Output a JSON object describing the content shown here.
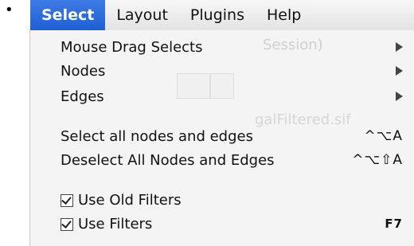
{
  "menubar": {
    "items": [
      {
        "label": "Select",
        "active": true
      },
      {
        "label": "Layout",
        "active": false
      },
      {
        "label": "Plugins",
        "active": false
      },
      {
        "label": "Help",
        "active": false
      }
    ]
  },
  "background_ghost": {
    "window_title_fragment": "Session)",
    "file_name": "galFiltered.sif"
  },
  "menu": {
    "mouse_drag_selects": "Mouse Drag Selects",
    "nodes": "Nodes",
    "edges": "Edges",
    "select_all": "Select all nodes and edges",
    "select_all_shortcut": "^⌥A",
    "deselect_all": "Deselect All Nodes and Edges",
    "deselect_all_shortcut": "^⌥⇧A",
    "use_old_filters": "Use Old Filters",
    "use_filters": "Use Filters",
    "use_filters_shortcut": "F7"
  },
  "colors": {
    "accent": "#2a67d8",
    "menu_bg": "#f4f4f4",
    "menubar_bg": "#ececec"
  }
}
